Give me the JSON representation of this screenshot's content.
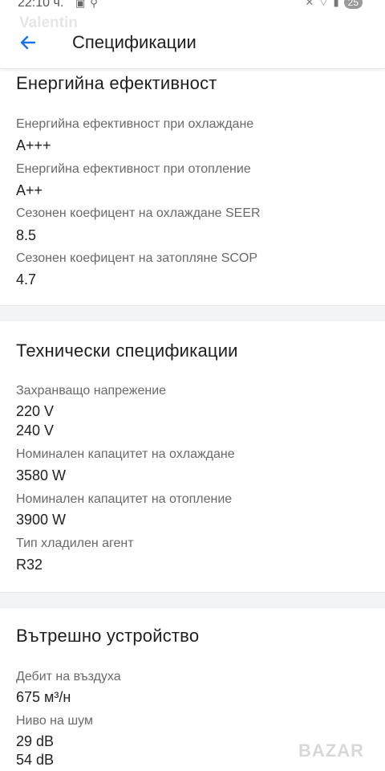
{
  "status_bar": {
    "time": "22:10 ч.",
    "battery": "25"
  },
  "watermark_user": "Valentin",
  "header": {
    "title": "Спецификации"
  },
  "energy": {
    "title": "Енергийна ефективност",
    "items": [
      {
        "label": "Енергийна ефективност при охлаждане",
        "value": "A+++"
      },
      {
        "label": "Енергийна ефективност при отопление",
        "value": "A++"
      },
      {
        "label": "Сезонен коефицент на охлаждане SEER",
        "value": "8.5"
      },
      {
        "label": "Сезонен коефицент на затопляне SCOP",
        "value": "4.7"
      }
    ]
  },
  "technical": {
    "title": "Технически спецификации",
    "items": [
      {
        "label": "Захранващо напрежение",
        "values": [
          "220 V",
          "240 V"
        ]
      },
      {
        "label": "Номинален капацитет на охлаждане",
        "values": [
          "3580 W"
        ]
      },
      {
        "label": "Номинален капацитет на отопление",
        "values": [
          "3900 W"
        ]
      },
      {
        "label": "Тип хладилен агент",
        "values": [
          "R32"
        ]
      }
    ]
  },
  "indoor": {
    "title": "Вътрешно устройство",
    "items": [
      {
        "label": "Дебит на въздуха",
        "values": [
          "675 м³/н"
        ]
      },
      {
        "label": "Ниво на шум",
        "values": [
          "29 dB",
          "54 dB"
        ]
      }
    ]
  },
  "logo_text": "BAZAR"
}
